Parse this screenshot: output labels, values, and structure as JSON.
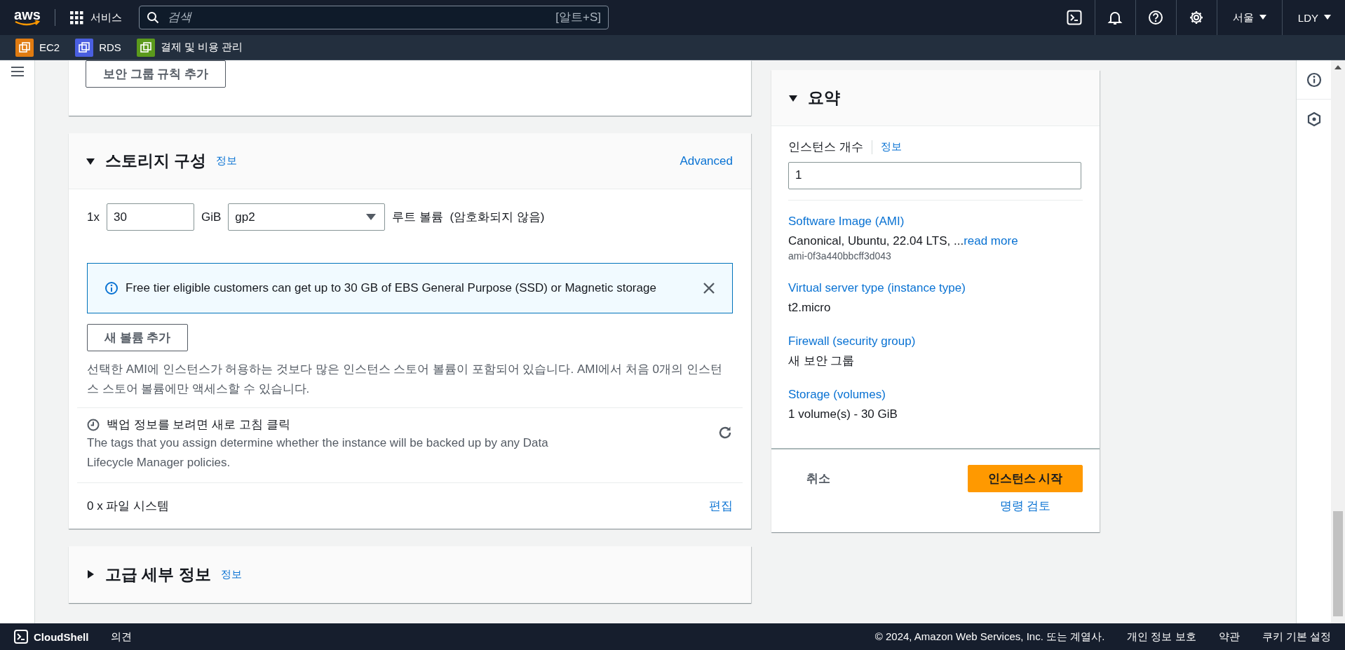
{
  "top_nav": {
    "logo": "aws",
    "services_label": "서비스",
    "search": {
      "placeholder": "검색",
      "shortcut": "[알트+S]"
    },
    "region": "서울",
    "user": "LDY"
  },
  "favorites": [
    {
      "label": "EC2",
      "color": "#e07b11"
    },
    {
      "label": "RDS",
      "color": "#4a5fe0"
    },
    {
      "label": "결제 및 비용 관리",
      "color": "#5b9a1c"
    }
  ],
  "security_group": {
    "add_rule_button": "보안 그룹 규칙 추가"
  },
  "storage": {
    "title": "스토리지 구성",
    "expanded": true,
    "info_link": "정보",
    "advanced_link": "Advanced",
    "volume": {
      "multiplier": "1x",
      "size": "30",
      "unit": "GiB",
      "type": "gp2",
      "description": "루트 볼륨  (암호화되지 않음)"
    },
    "alert": "Free tier eligible customers can get up to 30 GB of EBS General Purpose (SSD) or Magnetic storage",
    "add_volume_button": "새 볼륨 추가",
    "note": "선택한 AMI에 인스턴스가 허용하는 것보다 많은 인스턴스 스토어 볼륨이 포함되어 있습니다. AMI에서 처음 0개의 인스턴스 스토어 볼륨에만 액세스할 수 있습니다.",
    "backup": {
      "title": "백업 정보를 보려면 새로 고침 클릭",
      "description": "The tags that you assign determine whether the instance will be backed up by any Data Lifecycle Manager policies."
    },
    "file_systems": {
      "label": "0 x 파일 시스템",
      "edit_link": "편집"
    }
  },
  "advanced": {
    "title": "고급 세부 정보",
    "expanded": false,
    "info_link": "정보"
  },
  "summary": {
    "title": "요약",
    "expanded": true,
    "instance_count_label": "인스턴스 개수",
    "info_link": "정보",
    "instance_count": "1",
    "items": [
      {
        "label": "Software Image (AMI)",
        "value": "Canonical, Ubuntu, 22.04 LTS, ...",
        "link": "read more",
        "sub": "ami-0f3a440bbcff3d043"
      },
      {
        "label": "Virtual server type (instance type)",
        "value": "t2.micro"
      },
      {
        "label": "Firewall (security group)",
        "value": "새 보안 그룹"
      },
      {
        "label": "Storage (volumes)",
        "value": "1 volume(s) - 30 GiB"
      }
    ],
    "cancel_button": "취소",
    "launch_button": "인스턴스 시작",
    "review_link": "명령 검토"
  },
  "footer": {
    "cloudshell": "CloudShell",
    "feedback": "의견",
    "copyright": "© 2024, Amazon Web Services, Inc. 또는 계열사.",
    "links": [
      "개인 정보 보호",
      "약관",
      "쿠키 기본 설정"
    ]
  }
}
